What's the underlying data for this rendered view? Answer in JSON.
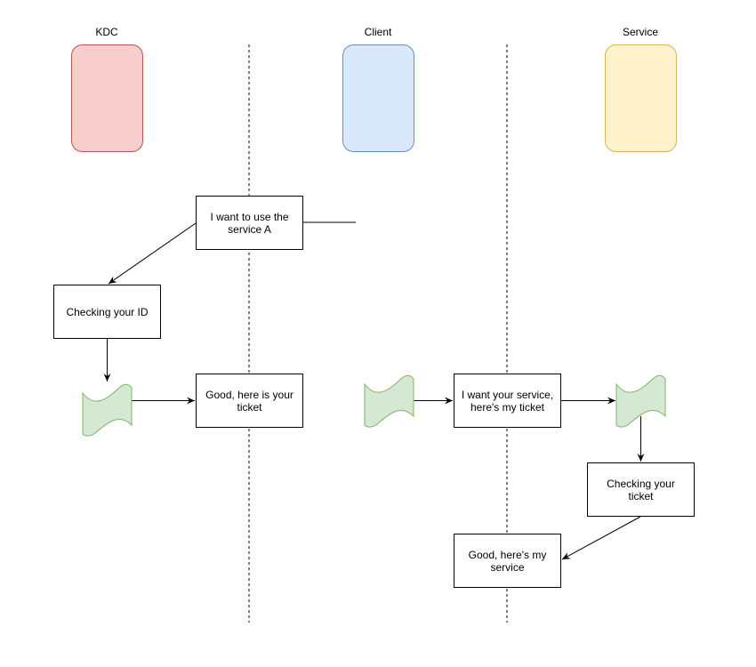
{
  "diagram": {
    "type": "sequence / flow diagram",
    "lanes": [
      {
        "id": "kdc",
        "title": "KDC",
        "fill": "#f8cecc",
        "stroke": "#b85450"
      },
      {
        "id": "client",
        "title": "Client",
        "fill": "#dae8fc",
        "stroke": "#6c8ebf"
      },
      {
        "id": "service",
        "title": "Service",
        "fill": "#fff2cc",
        "stroke": "#d6b656"
      }
    ],
    "boxes": {
      "want_service_a": "I want to use the service A",
      "checking_id": "Checking your ID",
      "here_ticket": "Good, here is your ticket",
      "want_your_service": "I want your service, here's my ticket",
      "checking_ticket": "Checking your ticket",
      "here_service": "Good, here's my service"
    },
    "ticket_fill": "#d5e8d4",
    "ticket_stroke": "#82b366"
  }
}
